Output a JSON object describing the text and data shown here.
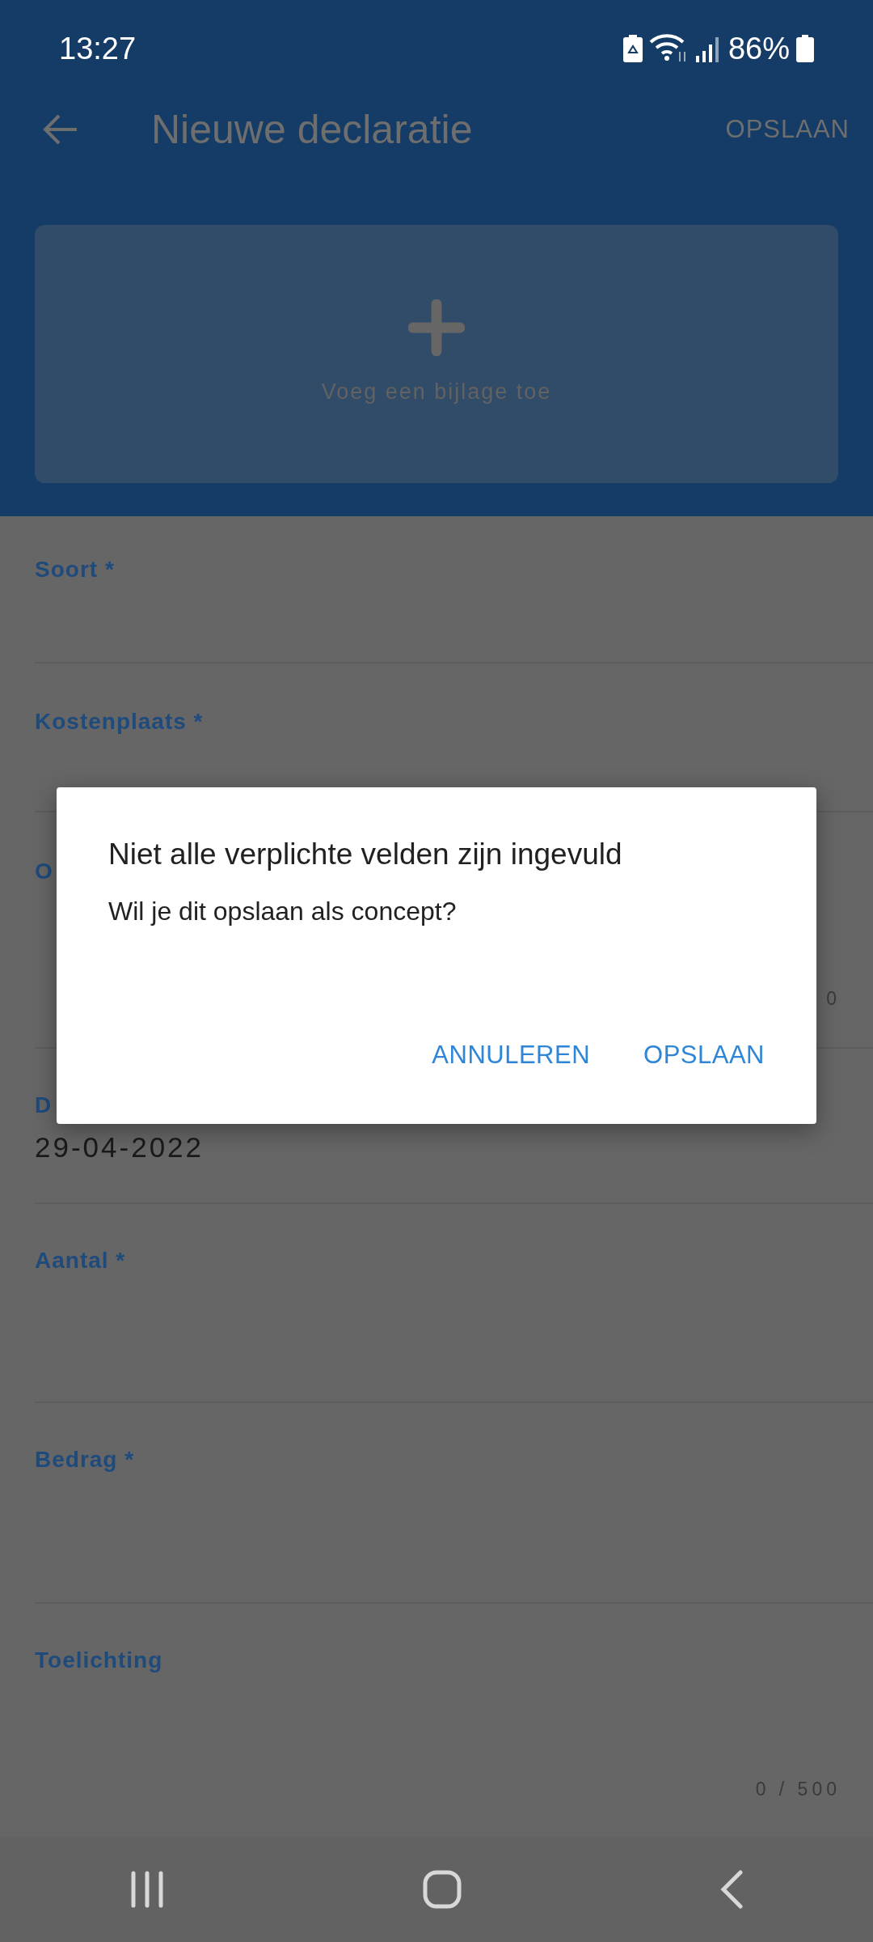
{
  "status_bar": {
    "time": "13:27",
    "battery": "86%"
  },
  "app_bar": {
    "title": "Nieuwe declaratie",
    "action": "OPSLAAN"
  },
  "attachment": {
    "label": "Voeg een bijlage toe"
  },
  "fields": [
    {
      "label": "Soort *"
    },
    {
      "label": "Kostenplaats *"
    },
    {
      "label": "O",
      "counter": "0"
    },
    {
      "label": "D",
      "value": "29-04-2022"
    },
    {
      "label": "Aantal *"
    },
    {
      "label": "Bedrag *"
    },
    {
      "label": "Toelichting",
      "counter": "0 / 500"
    }
  ],
  "dialog": {
    "title": "Niet alle verplichte velden zijn ingevuld",
    "message": "Wil je dit opslaan als concept?",
    "buttons": [
      "ANNULEREN",
      "OPSLAAN"
    ]
  }
}
